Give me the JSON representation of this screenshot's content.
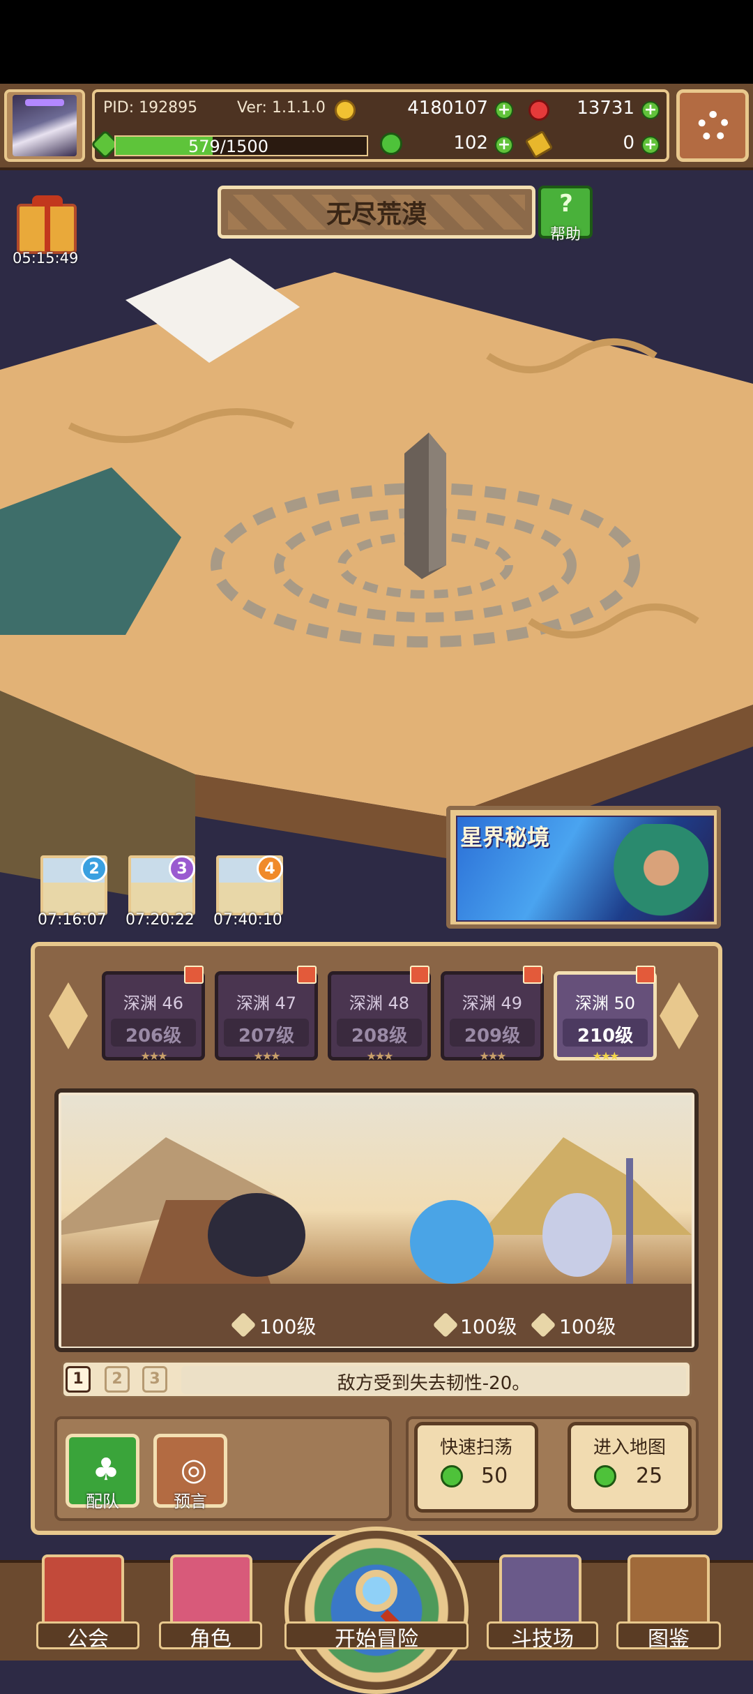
{
  "player": {
    "pid_label": "PID: 192895",
    "version_label": "Ver: 1.1.1.0",
    "gold": "4180107",
    "gems": "13731",
    "energy_text": "579/1500",
    "energy_fraction": 0.386,
    "clover": "102",
    "keys": "0"
  },
  "gift": {
    "timer": "05:15:49"
  },
  "area": {
    "title": "无尽荒漠",
    "help_label": "帮助"
  },
  "stages": [
    {
      "badge": "2",
      "timer": "07:16:07",
      "badge_color": "#3aa0e0"
    },
    {
      "badge": "3",
      "timer": "07:20:22",
      "badge_color": "#9a5ad0"
    },
    {
      "badge": "4",
      "timer": "07:40:10",
      "badge_color": "#f08a2a"
    }
  ],
  "realm": {
    "label": "星界秘境"
  },
  "abyss_levels": [
    {
      "name": "深渊 46",
      "level": "206级",
      "stars": "★★★",
      "selected": false
    },
    {
      "name": "深渊 47",
      "level": "207级",
      "stars": "★★★",
      "selected": false
    },
    {
      "name": "深渊 48",
      "level": "208级",
      "stars": "★★★",
      "selected": false
    },
    {
      "name": "深渊 49",
      "level": "209级",
      "stars": "★★★",
      "selected": false
    },
    {
      "name": "深渊 50",
      "level": "210级",
      "stars": "★★★",
      "selected": true
    }
  ],
  "battle": {
    "party_levels": [
      "100级",
      "100级",
      "100级"
    ]
  },
  "skill": {
    "tabs": [
      "1",
      "2",
      "3"
    ],
    "selected_tab": "1",
    "text": "敌方受到失去韧性-20。"
  },
  "controls": {
    "team_label": "配队",
    "oracle_label": "预言",
    "sweep_label": "快速扫荡",
    "sweep_cost": "50",
    "enter_label": "进入地图",
    "enter_cost": "25"
  },
  "nav": {
    "guild": "公会",
    "character": "角色",
    "adventure": "开始冒险",
    "arena": "斗技场",
    "codex": "图鉴"
  },
  "icons": [
    "settings-gear-icon",
    "gold-coin-icon",
    "red-gem-icon",
    "energy-clover-icon",
    "key-icon",
    "gift-box-icon",
    "help-question-icon",
    "magnifier-icon"
  ],
  "colors": {
    "frame": "#e8c88d",
    "panel": "#8a6546",
    "accent_green": "#5ec43a",
    "gem_red": "#e53a3a"
  }
}
